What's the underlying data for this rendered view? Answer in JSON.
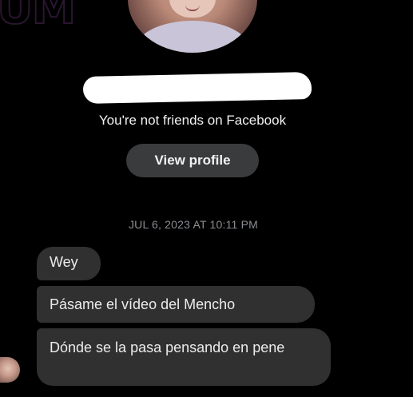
{
  "header": {
    "brand_logo_text": "UM",
    "not_friends_text": "You're not friends on Facebook",
    "view_profile_label": "View profile"
  },
  "conversation": {
    "timestamp": "JUL 6, 2023 AT 10:11 PM",
    "messages": [
      {
        "text": "Wey"
      },
      {
        "text": "Pásame el vídeo del Mencho"
      },
      {
        "text": "Dónde se la pasa pensando en pene"
      }
    ]
  },
  "colors": {
    "background": "#000000",
    "bubble": "#303030",
    "button": "#3a3b3c",
    "timestamp": "#8a8d91",
    "redaction": "#ffffff"
  },
  "icons": {
    "profile_avatar": "profile-photo",
    "sender_avatar": "sender-avatar"
  }
}
